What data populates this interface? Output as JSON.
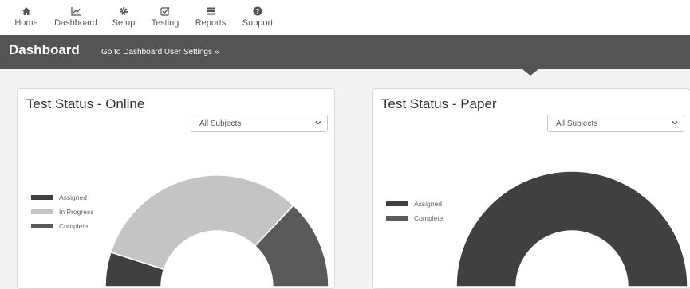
{
  "nav": [
    {
      "label": "Home",
      "icon": "home-icon"
    },
    {
      "label": "Dashboard",
      "icon": "line-chart-icon"
    },
    {
      "label": "Setup",
      "icon": "gear-icon"
    },
    {
      "label": "Testing",
      "icon": "checkbox-icon"
    },
    {
      "label": "Reports",
      "icon": "report-icon"
    },
    {
      "label": "Support",
      "icon": "question-icon"
    }
  ],
  "header": {
    "title": "Dashboard",
    "settings_link": "Go to Dashboard User Settings »"
  },
  "panels": [
    {
      "title": "Test Status - Online",
      "filter": "All Subjects",
      "legend": [
        {
          "label": "Assigned",
          "color": "#404040"
        },
        {
          "label": "In Progress",
          "color": "#c4c4c4"
        },
        {
          "label": "Complete",
          "color": "#5a5a5a"
        }
      ]
    },
    {
      "title": "Test Status - Paper",
      "filter": "All Subjects",
      "legend": [
        {
          "label": "Assigned",
          "color": "#404040"
        },
        {
          "label": "Complete",
          "color": "#5a5a5a"
        }
      ]
    }
  ],
  "chart_data": [
    {
      "type": "pie",
      "variant": "half-donut",
      "title": "Test Status - Online",
      "categories": [
        "Assigned",
        "In Progress",
        "Complete"
      ],
      "values": [
        0.1,
        0.64,
        0.26
      ],
      "colors": [
        "#404040",
        "#c4c4c4",
        "#5a5a5a"
      ]
    },
    {
      "type": "pie",
      "variant": "half-donut",
      "title": "Test Status - Paper",
      "categories": [
        "Assigned",
        "Complete"
      ],
      "values": [
        1.0,
        0.0
      ],
      "colors": [
        "#404040",
        "#5a5a5a"
      ]
    }
  ]
}
